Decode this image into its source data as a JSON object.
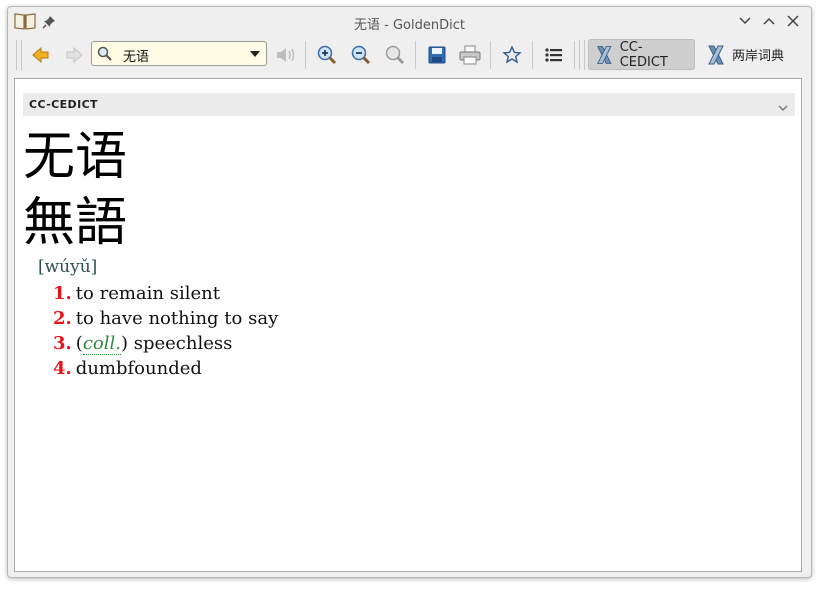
{
  "window": {
    "title": "无语 - GoldenDict"
  },
  "toolbar": {
    "search_value": "无语",
    "dictionaries": [
      {
        "label": "CC-CEDICT",
        "active": true
      },
      {
        "label": "两岸词典",
        "active": false
      }
    ]
  },
  "article": {
    "dictionary_name": "CC-CEDICT",
    "headword_simplified": "无语",
    "headword_traditional": "無語",
    "pinyin": "[wúyǔ]",
    "definitions": [
      {
        "num": "1.",
        "text": "to remain silent"
      },
      {
        "num": "2.",
        "text": "to have nothing to say"
      },
      {
        "num": "3.",
        "open": "(",
        "abbr": "coll.",
        "close": ") speechless"
      },
      {
        "num": "4.",
        "text": "dumbfounded"
      }
    ]
  },
  "colors": {
    "definition_number": "#e8141a",
    "pinyin": "#2a5050",
    "abbreviation": "#2c8a3e"
  },
  "icons": [
    "book-icon",
    "pin-icon",
    "minimize-icon",
    "maximize-icon",
    "close-icon",
    "back-icon",
    "forward-icon",
    "search-icon",
    "speaker-icon",
    "zoom-in-icon",
    "zoom-out-icon",
    "zoom-reset-icon",
    "save-icon",
    "print-icon",
    "star-icon",
    "list-icon",
    "dictionary-icon",
    "chevron-down-icon"
  ]
}
